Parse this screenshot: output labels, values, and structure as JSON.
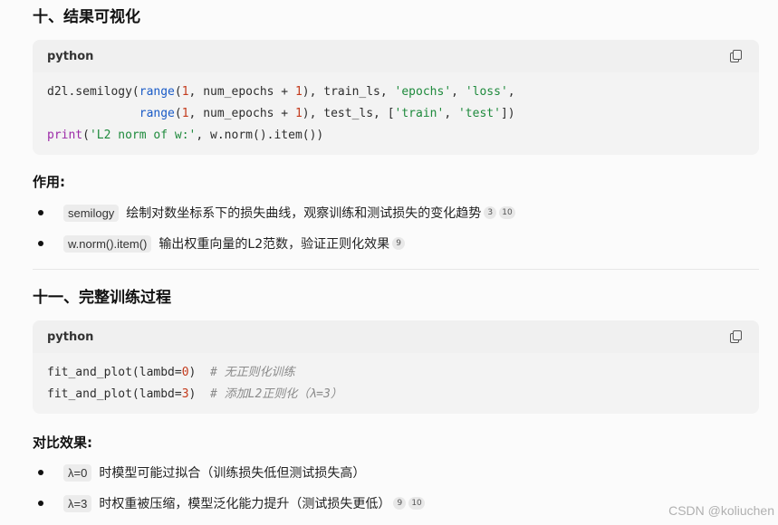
{
  "section10": {
    "title": "十、结果可视化",
    "code": {
      "lang": "python",
      "lines": [
        [
          [
            "fn",
            "d2l.semilogy("
          ],
          [
            "bi",
            "range"
          ],
          [
            "fn",
            "("
          ],
          [
            "num",
            "1"
          ],
          [
            "fn",
            ", num_epochs + "
          ],
          [
            "num",
            "1"
          ],
          [
            "fn",
            "), train_ls, "
          ],
          [
            "str",
            "'epochs'"
          ],
          [
            "fn",
            ", "
          ],
          [
            "str",
            "'loss'"
          ],
          [
            "fn",
            ","
          ]
        ],
        [
          [
            "fn",
            "             "
          ],
          [
            "bi",
            "range"
          ],
          [
            "fn",
            "("
          ],
          [
            "num",
            "1"
          ],
          [
            "fn",
            ", num_epochs + "
          ],
          [
            "num",
            "1"
          ],
          [
            "fn",
            "), test_ls, ["
          ],
          [
            "str",
            "'train'"
          ],
          [
            "fn",
            ", "
          ],
          [
            "str",
            "'test'"
          ],
          [
            "fn",
            "])"
          ]
        ],
        [
          [
            "kw",
            "print"
          ],
          [
            "fn",
            "("
          ],
          [
            "str",
            "'L2 norm of w:'"
          ],
          [
            "fn",
            ", w.norm().item())"
          ]
        ]
      ]
    },
    "label": "作用:",
    "bullets": [
      {
        "code": "semilogy",
        "text": "绘制对数坐标系下的损失曲线，观察训练和测试损失的变化趋势",
        "cites": [
          "3",
          "10"
        ]
      },
      {
        "code": "w.norm().item()",
        "text": "输出权重向量的L2范数，验证正则化效果",
        "cites": [
          "9"
        ]
      }
    ]
  },
  "section11": {
    "title": "十一、完整训练过程",
    "code": {
      "lang": "python",
      "lines": [
        [
          [
            "fn",
            "fit_and_plot(lambd="
          ],
          [
            "num",
            "0"
          ],
          [
            "fn",
            ")  "
          ],
          [
            "cm",
            "# 无正则化训练"
          ]
        ],
        [
          [
            "fn",
            "fit_and_plot(lambd="
          ],
          [
            "num",
            "3"
          ],
          [
            "fn",
            ")  "
          ],
          [
            "cm",
            "# 添加L2正则化（λ=3）"
          ]
        ]
      ]
    },
    "label": "对比效果:",
    "bullets": [
      {
        "code": "λ=0",
        "text": "时模型可能过拟合（训练损失低但测试损失高）",
        "cites": []
      },
      {
        "code": "λ=3",
        "text": "时权重被压缩，模型泛化能力提升（测试损失更低）",
        "cites": [
          "9",
          "10"
        ]
      }
    ]
  },
  "watermark": "CSDN @koliuchen",
  "icons": {
    "copy": "copy-icon"
  }
}
